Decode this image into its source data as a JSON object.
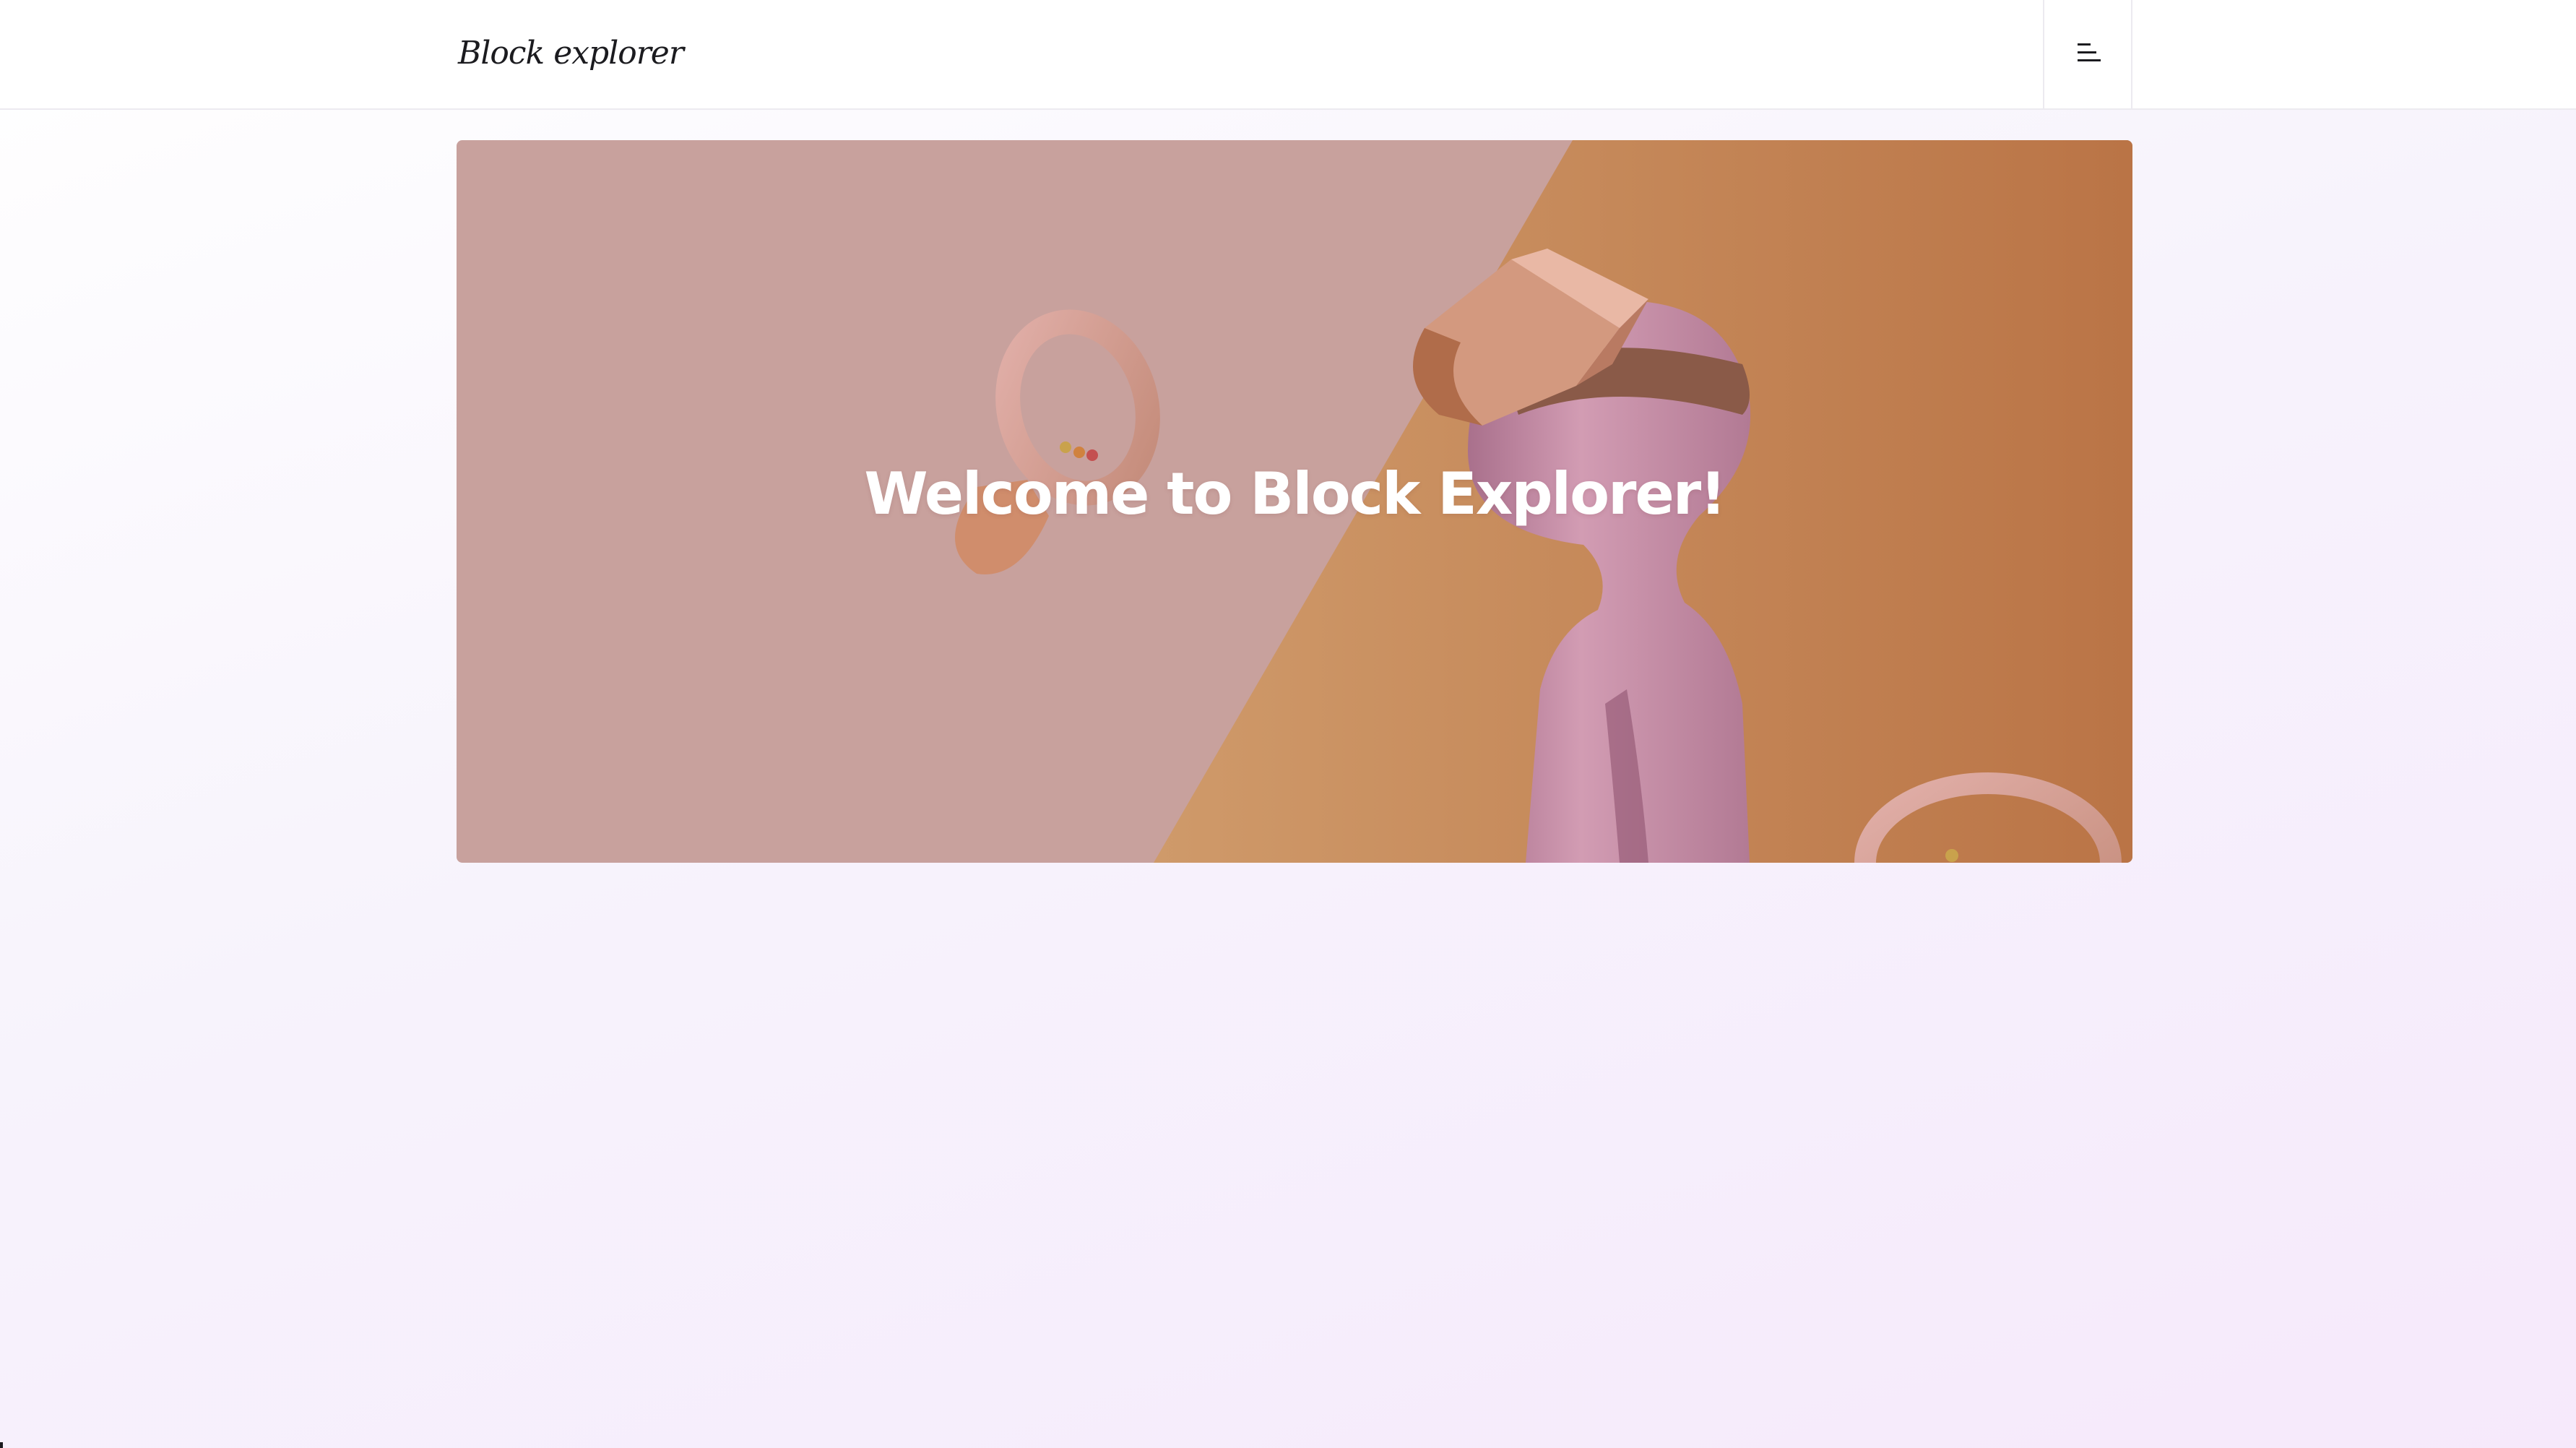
{
  "header": {
    "brand": "Block explorer",
    "menu_icon": "menu-icon"
  },
  "hero": {
    "title": "Welcome to Block Explorer!",
    "image": "vr-headset-figure-illustration"
  },
  "colors": {
    "hero_left": "#c8a19d",
    "hero_right": "#c98a55",
    "figure": "#c98da2",
    "brand_text": "#1b1b1f"
  }
}
